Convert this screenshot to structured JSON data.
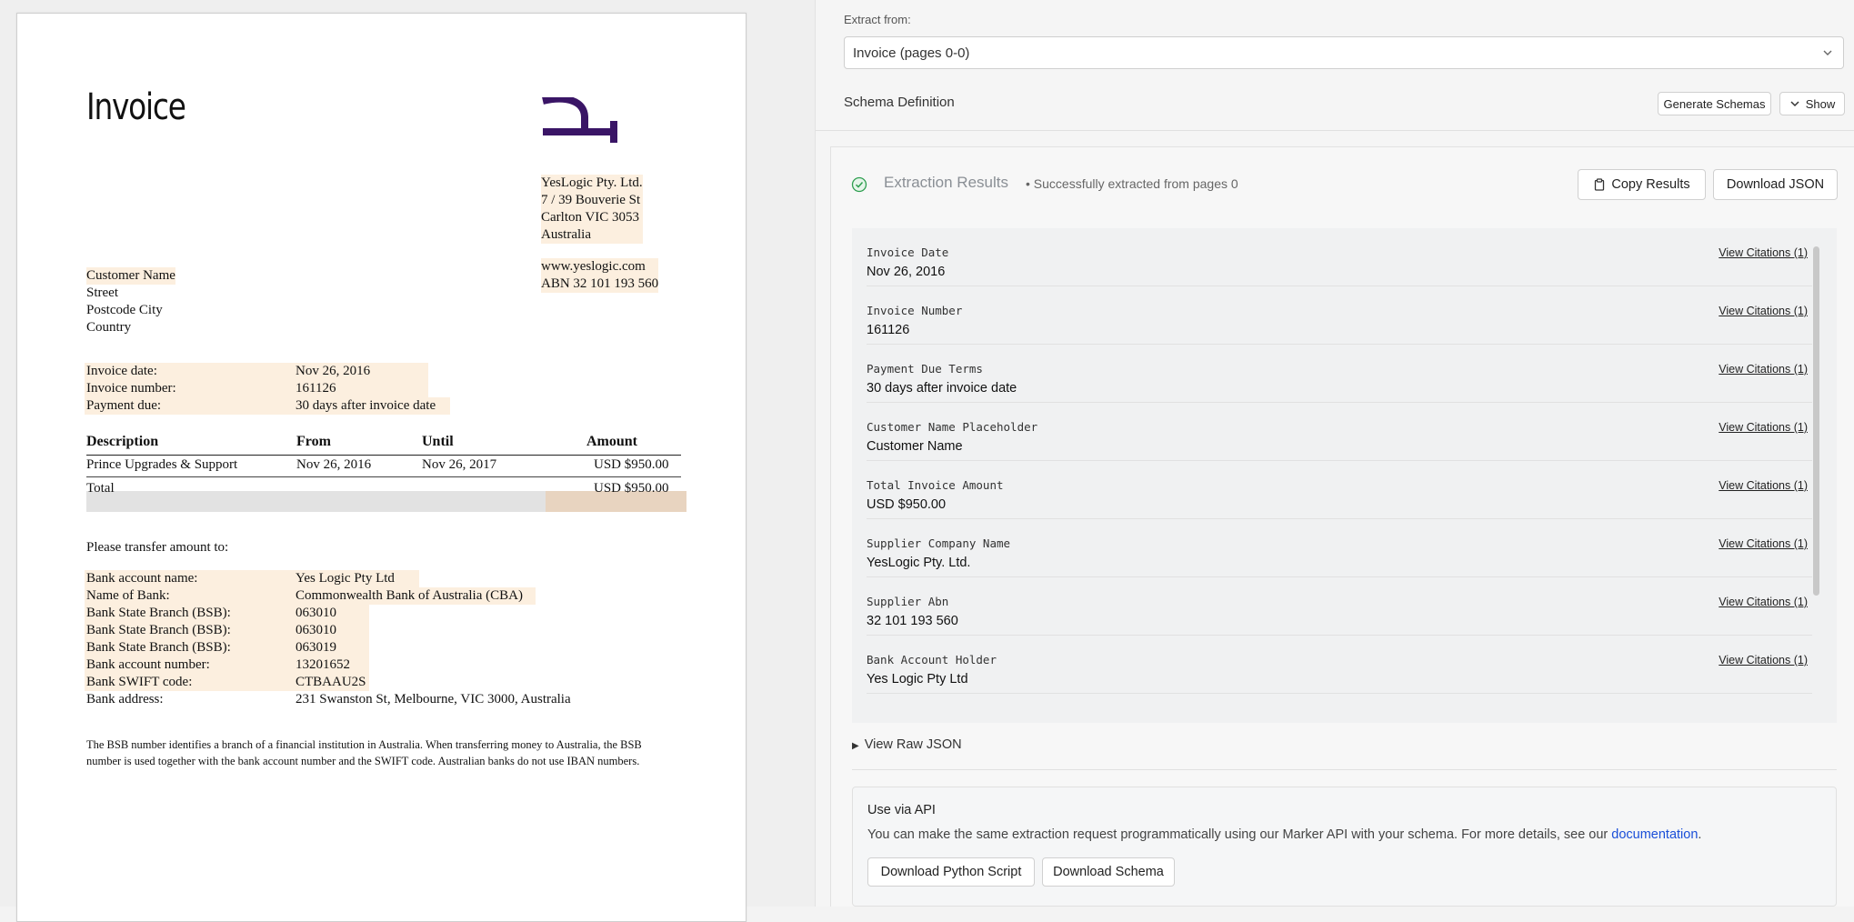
{
  "invoice": {
    "title": "Invoice",
    "supplier": [
      "YesLogic Pty. Ltd.",
      "7 / 39 Bouverie St",
      "Carlton VIC 3053",
      "Australia"
    ],
    "web": [
      "www.yeslogic.com",
      "ABN 32 101 193 560"
    ],
    "customer": [
      "Customer Name",
      "Street",
      "Postcode City",
      "Country"
    ],
    "meta": [
      {
        "label": "Invoice date:",
        "value": "Nov 26, 2016"
      },
      {
        "label": "Invoice number:",
        "value": "161126"
      },
      {
        "label": "Payment due:",
        "value": "30 days after invoice date"
      }
    ],
    "table": {
      "headers": [
        "Description",
        "From",
        "Until",
        "Amount"
      ],
      "row": [
        "Prince Upgrades & Support",
        "Nov 26, 2016",
        "Nov 26, 2017",
        "USD $950.00"
      ],
      "total_label": "Total",
      "total_value": "USD $950.00"
    },
    "transfer_text": "Please transfer amount to:",
    "bank": [
      {
        "label": "Bank account name:",
        "value": "Yes Logic Pty Ltd"
      },
      {
        "label": "Name of Bank:",
        "value": "Commonwealth Bank of Australia (CBA)"
      },
      {
        "label": "Bank State Branch (BSB):",
        "value": "063010"
      },
      {
        "label": "Bank State Branch (BSB):",
        "value": "063010"
      },
      {
        "label": "Bank State Branch (BSB):",
        "value": "063019"
      },
      {
        "label": "Bank account number:",
        "value": "13201652"
      },
      {
        "label": "Bank SWIFT code:",
        "value": "CTBAAU2S"
      },
      {
        "label": "Bank address:",
        "value": "231 Swanston St, Melbourne, VIC 3000, Australia"
      }
    ],
    "note": "The BSB number identifies a branch of a financial institution in Australia. When transferring money to Australia, the BSB number is used together with the bank account number and the SWIFT code. Australian banks do not use IBAN numbers."
  },
  "panel": {
    "extract_label": "Extract from:",
    "extract_value": "Invoice (pages 0-0)",
    "schema_title": "Schema Definition",
    "generate_label": "Generate Schemas",
    "show_label": "Show",
    "results_title": "Extraction Results",
    "results_sub": "• Successfully extracted from pages 0",
    "copy_label": "Copy Results",
    "download_json_label": "Download JSON",
    "fields": [
      {
        "key": "Invoice Date",
        "value": "Nov 26, 2016",
        "cite": "View Citations (1)"
      },
      {
        "key": "Invoice Number",
        "value": "161126",
        "cite": "View Citations (1)"
      },
      {
        "key": "Payment Due Terms",
        "value": "30 days after invoice date",
        "cite": "View Citations (1)"
      },
      {
        "key": "Customer Name Placeholder",
        "value": "Customer Name",
        "cite": "View Citations (1)"
      },
      {
        "key": "Total Invoice Amount",
        "value": "USD $950.00",
        "cite": "View Citations (1)"
      },
      {
        "key": "Supplier Company Name",
        "value": "YesLogic Pty. Ltd.",
        "cite": "View Citations (1)"
      },
      {
        "key": "Supplier Abn",
        "value": "32 101 193 560",
        "cite": "View Citations (1)"
      },
      {
        "key": "Bank Account Holder",
        "value": "Yes Logic Pty Ltd",
        "cite": "View Citations (1)"
      }
    ],
    "raw_json_label": "View Raw JSON",
    "api_title": "Use via API",
    "api_desc": "You can make the same extraction request programmatically using our Marker API with your schema. For more details, see our",
    "api_link": "documentation",
    "api_end": ".",
    "python_label": "Download Python Script",
    "schema_dl_label": "Download Schema"
  },
  "colors": {
    "logo": "#3a1566",
    "highlight": "#fcefdf",
    "link": "#1a4fd8",
    "success": "#2e9e4f"
  },
  "icons": {
    "logo": "yeslogic-logo",
    "chevron": "chevron-down-icon",
    "check": "check-circle-icon",
    "clipboard": "clipboard-icon",
    "triangle": "caret-right-icon"
  }
}
